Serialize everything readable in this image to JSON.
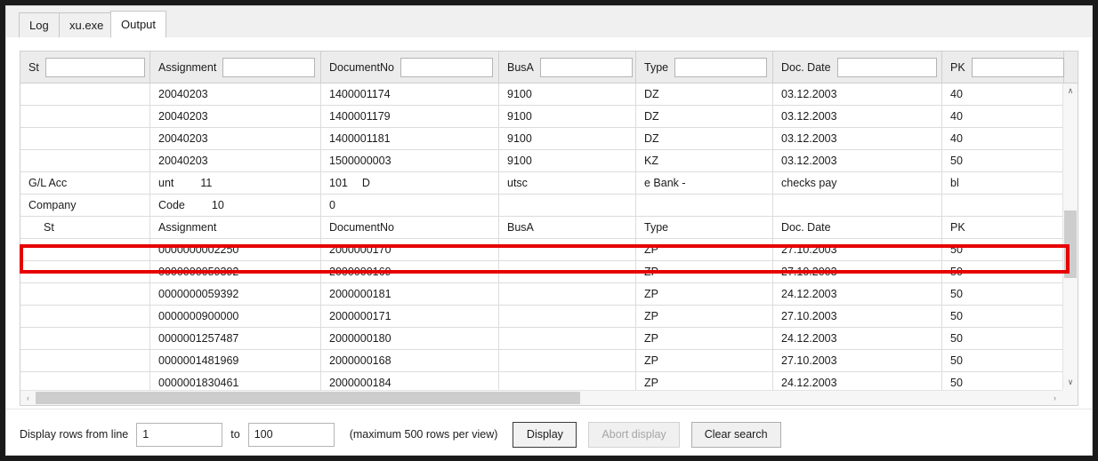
{
  "window": {
    "tabs": [
      {
        "label": "Log",
        "active": false
      },
      {
        "label": "xu.exe",
        "active": false
      },
      {
        "label": "Output",
        "active": true
      }
    ]
  },
  "grid": {
    "columns": [
      {
        "key": "st",
        "label": "St"
      },
      {
        "key": "assignment",
        "label": "Assignment"
      },
      {
        "key": "documentno",
        "label": "DocumentNo"
      },
      {
        "key": "busa",
        "label": "BusA"
      },
      {
        "key": "type",
        "label": "Type"
      },
      {
        "key": "docdate",
        "label": "Doc. Date"
      },
      {
        "key": "pk",
        "label": "PK"
      }
    ],
    "filters": {
      "st": "",
      "assignment": "",
      "documentno": "",
      "busa": "",
      "type": "",
      "docdate": "",
      "pk": ""
    },
    "rows": [
      {
        "st": "",
        "assignment": "20040203",
        "documentno": "1400001174",
        "busa": "9100",
        "type": "DZ",
        "docdate": "03.12.2003",
        "pk": "40"
      },
      {
        "st": "",
        "assignment": "20040203",
        "documentno": "1400001179",
        "busa": "9100",
        "type": "DZ",
        "docdate": "03.12.2003",
        "pk": "40"
      },
      {
        "st": "",
        "assignment": "20040203",
        "documentno": "1400001181",
        "busa": "9100",
        "type": "DZ",
        "docdate": "03.12.2003",
        "pk": "40"
      },
      {
        "st": "",
        "assignment": "20040203",
        "documentno": "1500000003",
        "busa": "9100",
        "type": "KZ",
        "docdate": "03.12.2003",
        "pk": "50"
      },
      {
        "st": "G/L Acc",
        "assignment": "unt",
        "assignment_extra": "11",
        "documentno": "101",
        "documentno_extra": "D",
        "busa": "utsc",
        "type": "e Bank -",
        "docdate": "checks pay",
        "pk": "bl"
      },
      {
        "st": "Company",
        "assignment": "Code",
        "assignment_extra": "10",
        "documentno": "0",
        "busa": "",
        "type": "",
        "docdate": "",
        "pk": ""
      },
      {
        "st": "St",
        "assignment": "Assignment",
        "documentno": "DocumentNo",
        "busa": "BusA",
        "type": "Type",
        "docdate": "Doc. Date",
        "pk": "PK",
        "is_header": true,
        "highlighted": true
      },
      {
        "st": "",
        "assignment": "0000000002250",
        "documentno": "2000000170",
        "busa": "",
        "type": "ZP",
        "docdate": "27.10.2003",
        "pk": "50"
      },
      {
        "st": "",
        "assignment": "0000000059392",
        "documentno": "2000000169",
        "busa": "",
        "type": "ZP",
        "docdate": "27.10.2003",
        "pk": "50"
      },
      {
        "st": "",
        "assignment": "0000000059392",
        "documentno": "2000000181",
        "busa": "",
        "type": "ZP",
        "docdate": "24.12.2003",
        "pk": "50"
      },
      {
        "st": "",
        "assignment": "0000000900000",
        "documentno": "2000000171",
        "busa": "",
        "type": "ZP",
        "docdate": "27.10.2003",
        "pk": "50"
      },
      {
        "st": "",
        "assignment": "0000001257487",
        "documentno": "2000000180",
        "busa": "",
        "type": "ZP",
        "docdate": "24.12.2003",
        "pk": "50"
      },
      {
        "st": "",
        "assignment": "0000001481969",
        "documentno": "2000000168",
        "busa": "",
        "type": "ZP",
        "docdate": "27.10.2003",
        "pk": "50"
      },
      {
        "st": "",
        "assignment": "0000001830461",
        "documentno": "2000000184",
        "busa": "",
        "type": "ZP",
        "docdate": "24.12.2003",
        "pk": "50"
      }
    ]
  },
  "footer": {
    "display_rows_label": "Display rows from line",
    "from_value": "1",
    "to_label": "to",
    "to_value": "100",
    "max_note": "(maximum 500 rows per view)",
    "display_button": "Display",
    "abort_button": "Abort display",
    "clear_button": "Clear search"
  },
  "colors": {
    "highlight": "#e60000",
    "panel": "#ffffff",
    "chrome": "#f0f0f0"
  },
  "scrollbars": {
    "vertical_up": "∧",
    "vertical_down": "∨",
    "horizontal_left": "‹",
    "horizontal_right": "›"
  }
}
